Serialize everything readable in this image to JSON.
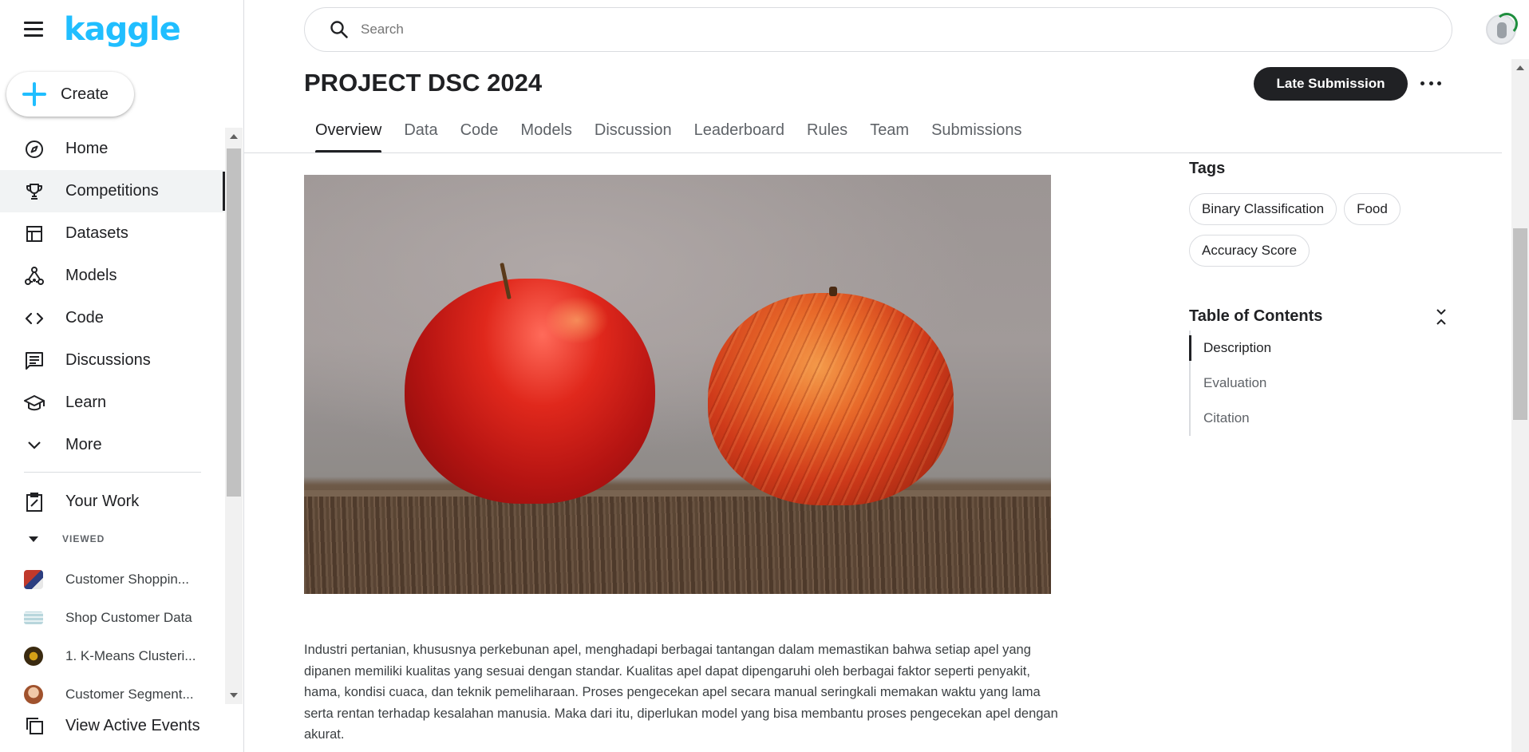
{
  "header": {
    "logo": "kaggle",
    "search_placeholder": "Search"
  },
  "sidebar": {
    "create_label": "Create",
    "items": [
      {
        "label": "Home",
        "icon": "compass-icon"
      },
      {
        "label": "Competitions",
        "icon": "trophy-icon",
        "active": true
      },
      {
        "label": "Datasets",
        "icon": "table-icon"
      },
      {
        "label": "Models",
        "icon": "models-icon"
      },
      {
        "label": "Code",
        "icon": "code-icon"
      },
      {
        "label": "Discussions",
        "icon": "comment-icon"
      },
      {
        "label": "Learn",
        "icon": "school-icon"
      },
      {
        "label": "More",
        "icon": "chevron-down-icon"
      }
    ],
    "your_work": "Your Work",
    "viewed_label": "VIEWED",
    "viewed": [
      {
        "label": "Customer Shoppin..."
      },
      {
        "label": "Shop Customer Data"
      },
      {
        "label": "1. K-Means Clusteri..."
      },
      {
        "label": "Customer Segment..."
      }
    ],
    "view_active_events": "View Active Events"
  },
  "competition": {
    "title": "PROJECT DSC 2024",
    "late_submission": "Late Submission",
    "tabs": [
      "Overview",
      "Data",
      "Code",
      "Models",
      "Discussion",
      "Leaderboard",
      "Rules",
      "Team",
      "Submissions"
    ],
    "active_tab": "Overview",
    "description": "Industri pertanian, khususnya perkebunan apel, menghadapi berbagai tantangan dalam memastikan bahwa setiap apel yang dipanen memiliki kualitas yang sesuai dengan standar. Kualitas apel dapat dipengaruhi oleh berbagai faktor seperti penyakit, hama, kondisi cuaca, dan teknik pemeliharaan. Proses pengecekan apel secara manual seringkali memakan waktu yang lama serta rentan terhadap kesalahan manusia. Maka dari itu, diperlukan model yang bisa membantu proses pengecekan apel dengan akurat."
  },
  "right_rail": {
    "tags_title": "Tags",
    "tags": [
      "Binary Classification",
      "Food",
      "Accuracy Score"
    ],
    "toc_title": "Table of Contents",
    "toc": [
      "Description",
      "Evaluation",
      "Citation"
    ],
    "toc_active": "Description"
  },
  "colors": {
    "brand": "#20beff",
    "primary_button": "#202124"
  }
}
